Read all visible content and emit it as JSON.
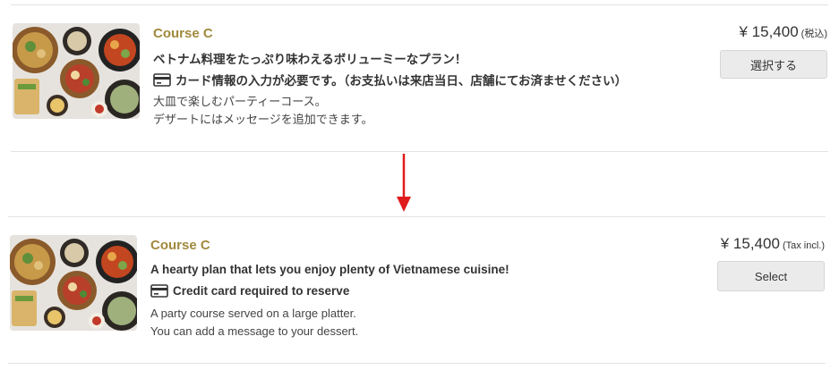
{
  "top_card": {
    "course_name": "Course C",
    "headline": "ベトナム料理をたっぷり味わえるボリューミーなプラン！",
    "requirement_icon": "credit-card-icon",
    "requirement": "カード情報の入力が必要です。（お支払いは来店当日、店舗にてお済ませください）",
    "description_lines": [
      "大皿で楽しむパーティーコース。",
      "デザートにはメッセージを追加できます。"
    ],
    "price": "¥ 15,400",
    "tax_note": "(税込)",
    "select_label": "選択する"
  },
  "arrow": {
    "icon": "down-arrow-icon",
    "color": "#e01b1b"
  },
  "bottom_card": {
    "course_name": "Course C",
    "headline": "A hearty plan that lets you enjoy plenty of Vietnamese cuisine!",
    "requirement_icon": "credit-card-icon",
    "requirement": "Credit card required to reserve",
    "description_lines": [
      "A party course served on a large platter.",
      "You can add a message to your dessert."
    ],
    "price": "¥ 15,400",
    "tax_note": "(Tax incl.)",
    "select_label": "Select"
  },
  "colors": {
    "course_title": "#a0893d",
    "button_bg": "#ebebeb",
    "divider": "#e3e3e3"
  }
}
